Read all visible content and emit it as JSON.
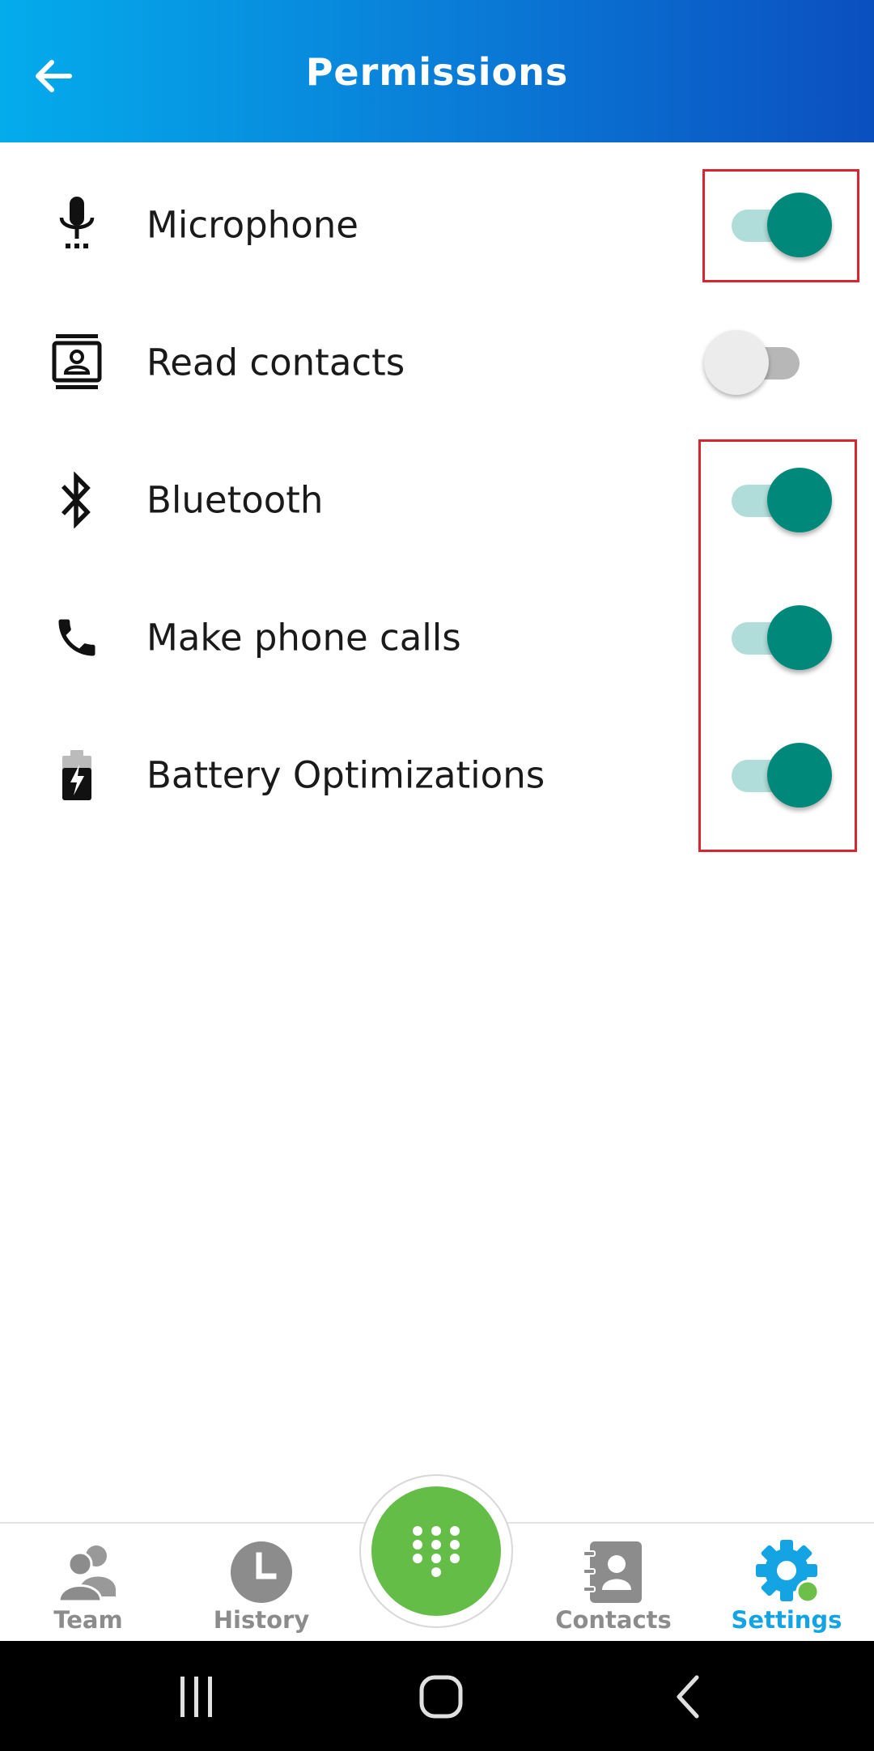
{
  "header": {
    "title": "Permissions",
    "colors": {
      "gradient_start": "#04acec",
      "gradient_end": "#0b4fbf"
    }
  },
  "permissions": [
    {
      "label": "Microphone",
      "icon": "microphone-icon",
      "enabled": true
    },
    {
      "label": "Read contacts",
      "icon": "contact-card-icon",
      "enabled": false
    },
    {
      "label": "Bluetooth",
      "icon": "bluetooth-icon",
      "enabled": true
    },
    {
      "label": "Make phone calls",
      "icon": "phone-icon",
      "enabled": true
    },
    {
      "label": "Battery Optimizations",
      "icon": "battery-charging-icon",
      "enabled": true
    }
  ],
  "toggle_colors": {
    "on_knob": "#00897b",
    "on_track": "#b0dcd9",
    "off_knob": "#ececec",
    "off_track": "#b7b7b7"
  },
  "highlight_color": "#d7262f",
  "bottom_nav": {
    "items": [
      {
        "label": "Team",
        "icon": "team-icon",
        "active": false
      },
      {
        "label": "History",
        "icon": "clock-icon",
        "active": false
      },
      {
        "label": "Contacts",
        "icon": "address-book-icon",
        "active": false
      },
      {
        "label": "Settings",
        "icon": "gear-icon",
        "active": true
      }
    ],
    "dialpad_icon": "dialpad-icon",
    "active_color": "#14a4e4",
    "dialpad_color": "#63bd47"
  },
  "system_nav": [
    "recent-apps-icon",
    "home-icon",
    "back-icon"
  ]
}
